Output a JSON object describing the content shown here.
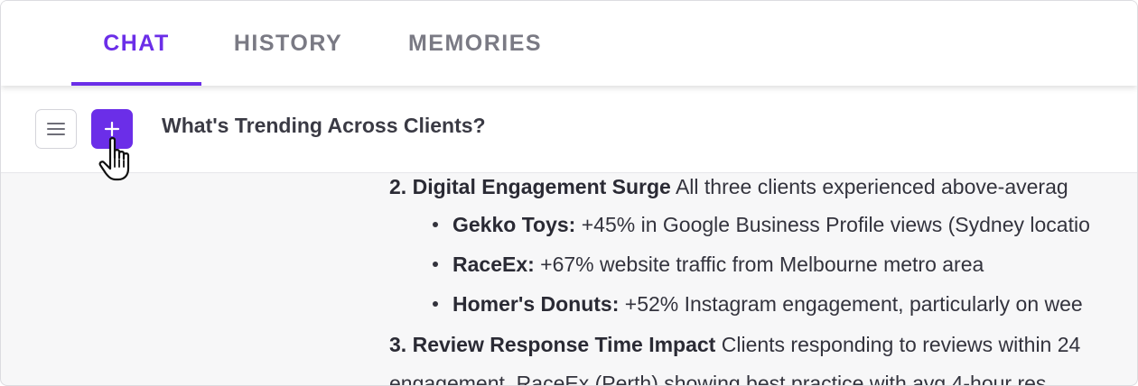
{
  "tabs": [
    {
      "label": "CHAT",
      "active": true
    },
    {
      "label": "HISTORY",
      "active": false
    },
    {
      "label": "MEMORIES",
      "active": false
    }
  ],
  "toolbar": {
    "menu_icon": "hamburger-icon",
    "new_icon": "plus-icon",
    "title": "What's Trending Across Clients?"
  },
  "colors": {
    "accent": "#6b2ee8",
    "tab_inactive": "#7a7a84",
    "text": "#33333d"
  },
  "content": {
    "item2": {
      "number": "2.",
      "heading": "Digital Engagement Surge",
      "text": "All three clients experienced above-averag",
      "bullets": [
        {
          "label": "Gekko Toys:",
          "text": "+45% in Google Business Profile views (Sydney locatio"
        },
        {
          "label": "RaceEx:",
          "text": "+67% website traffic from Melbourne metro area"
        },
        {
          "label": "Homer's Donuts:",
          "text": "+52% Instagram engagement, particularly on wee"
        }
      ]
    },
    "item3": {
      "number": "3.",
      "heading": "Review Response Time Impact",
      "text": "Clients responding to reviews within 24",
      "continuation": "engagement. RaceEx (Perth) showing best practice with avg 4-hour res"
    }
  }
}
